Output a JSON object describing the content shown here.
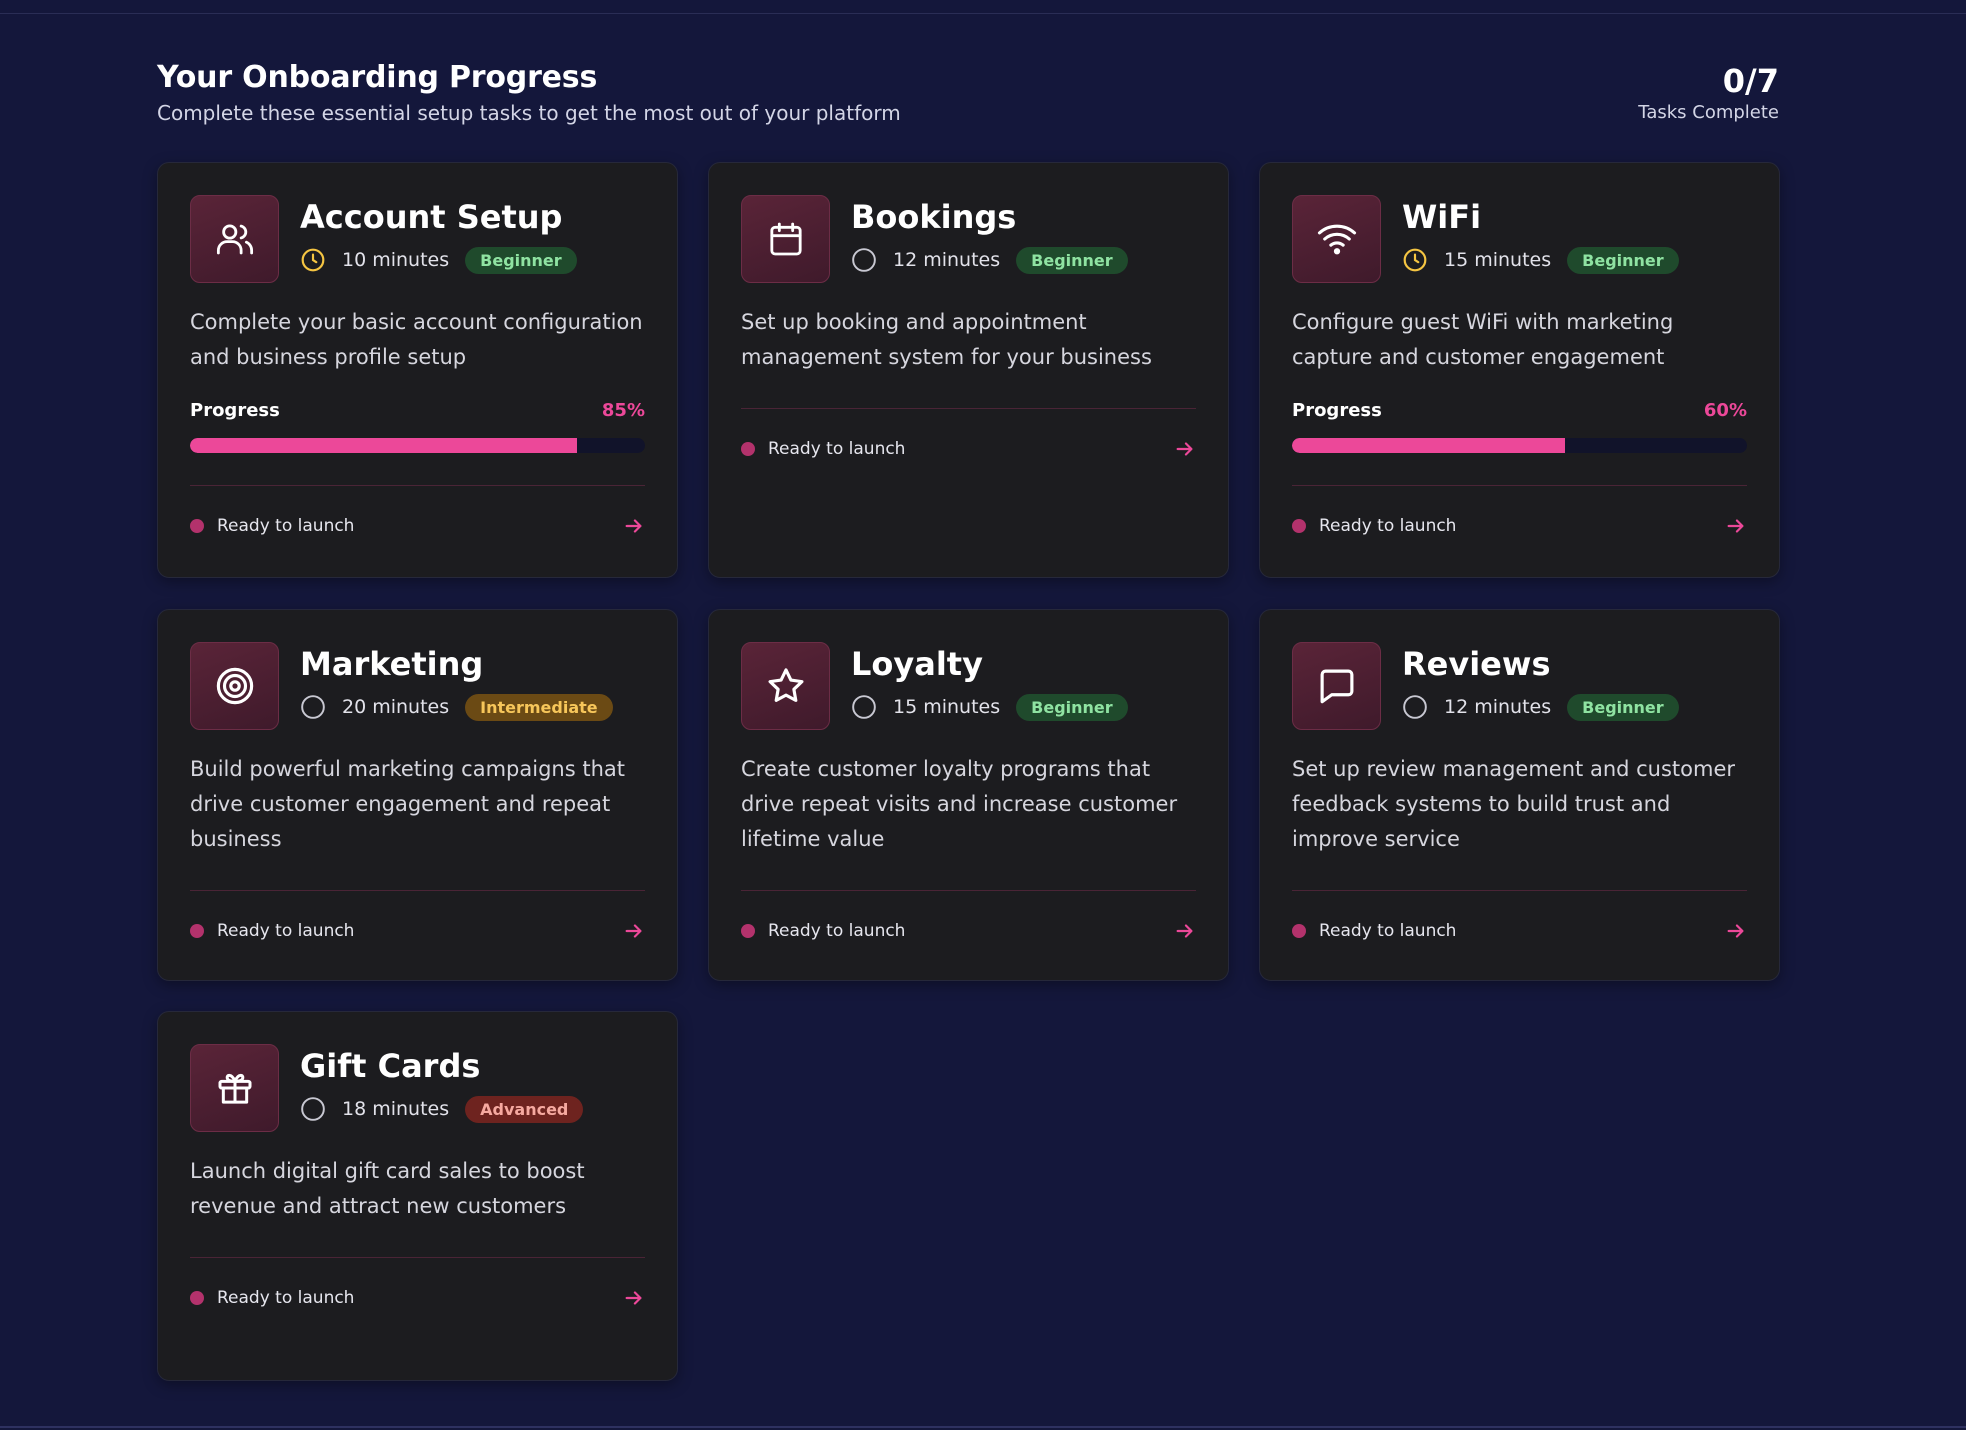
{
  "header": {
    "title": "Your Onboarding Progress",
    "subtitle": "Complete these essential setup tasks to get the most out of your platform",
    "count": "0/7",
    "count_label": "Tasks Complete"
  },
  "colors": {
    "background": "#14173b",
    "card": "#1c1c1f",
    "accent": "#ec4899",
    "beginner": "#1f4a2c",
    "intermediate": "#6b4a14",
    "advanced": "#6e231f"
  },
  "cards": [
    {
      "title": "Account Setup",
      "icon": "users-icon",
      "status_icon": "clock-icon",
      "minutes": "10 minutes",
      "level": "Beginner",
      "description": "Complete your basic account configuration and business profile setup",
      "progress_label": "Progress",
      "progress_text": "85%",
      "progress_value": 85,
      "status": "Ready to launch"
    },
    {
      "title": "Bookings",
      "icon": "calendar-icon",
      "status_icon": "circle-icon",
      "minutes": "12 minutes",
      "level": "Beginner",
      "description": "Set up booking and appointment management system for your business",
      "status": "Ready to launch"
    },
    {
      "title": "WiFi",
      "icon": "wifi-icon",
      "status_icon": "clock-icon",
      "minutes": "15 minutes",
      "level": "Beginner",
      "description": "Configure guest WiFi with marketing capture and customer engagement",
      "progress_label": "Progress",
      "progress_text": "60%",
      "progress_value": 60,
      "status": "Ready to launch"
    },
    {
      "title": "Marketing",
      "icon": "target-icon",
      "status_icon": "circle-icon",
      "minutes": "20 minutes",
      "level": "Intermediate",
      "description": "Build powerful marketing campaigns that drive customer engagement and repeat business",
      "status": "Ready to launch"
    },
    {
      "title": "Loyalty",
      "icon": "star-icon",
      "status_icon": "circle-icon",
      "minutes": "15 minutes",
      "level": "Beginner",
      "description": "Create customer loyalty programs that drive repeat visits and increase customer lifetime value",
      "status": "Ready to launch"
    },
    {
      "title": "Reviews",
      "icon": "message-icon",
      "status_icon": "circle-icon",
      "minutes": "12 minutes",
      "level": "Beginner",
      "description": "Set up review management and customer feedback systems to build trust and improve service",
      "status": "Ready to launch"
    },
    {
      "title": "Gift Cards",
      "icon": "gift-icon",
      "status_icon": "circle-icon",
      "minutes": "18 minutes",
      "level": "Advanced",
      "description": "Launch digital gift card sales to boost revenue and attract new customers",
      "status": "Ready to launch"
    }
  ]
}
